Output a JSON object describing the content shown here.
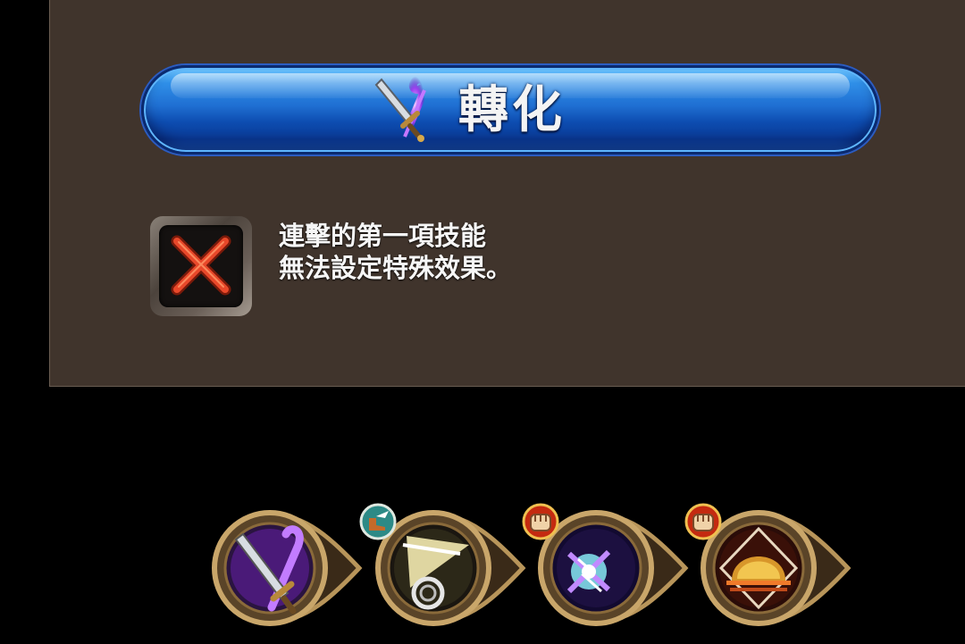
{
  "convert_button": {
    "label": "轉化",
    "icon": "sword-staff-icon"
  },
  "notice": {
    "icon": "red-x-icon",
    "lines": [
      "連擊的第一項技能",
      "無法設定特殊效果。"
    ]
  },
  "skills": [
    {
      "name": "sword-staff-skill",
      "icon": "sword-staff-icon",
      "badge": ""
    },
    {
      "name": "light-slash-skill",
      "icon": "light-slash-icon",
      "badge": "winged-boot-icon"
    },
    {
      "name": "lightning-burst-skill",
      "icon": "lightning-burst-icon",
      "badge": "fist-icon"
    },
    {
      "name": "dome-shield-skill",
      "icon": "dome-shield-icon",
      "badge": "fist-icon"
    }
  ],
  "colors": {
    "panel": "#40342c",
    "button_blue": "#1f6fd2",
    "x_red": "#e8482a"
  }
}
